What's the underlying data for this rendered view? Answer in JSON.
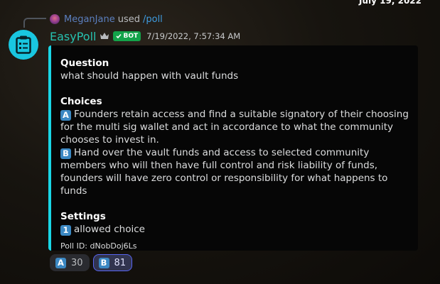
{
  "top_date": "July 19, 2022",
  "reply": {
    "user": "MeganJane",
    "used": "used",
    "command": "/poll"
  },
  "message": {
    "author": "EasyPoll",
    "bot_tag": "BOT",
    "timestamp": "7/19/2022, 7:57:34 AM",
    "avatar_icon": "clipboard-icon",
    "accent_color": "#19d6e6"
  },
  "embed": {
    "question_label": "Question",
    "question": "what should happen with vault funds",
    "choices_label": "Choices",
    "choices": [
      {
        "letter": "A",
        "text": "Founders retain access and find a suitable signatory of their choosing for the multi sig wallet and act in accordance to what the community chooses to invest in."
      },
      {
        "letter": "B",
        "text": "Hand over the vault funds and access to selected community members who will then have full control and risk liability of funds, founders will have zero control or responsibility for what happens to funds"
      }
    ],
    "settings_label": "Settings",
    "settings_number": "1",
    "settings_text": "allowed choice",
    "footer": "Poll ID: dNobDoj6Ls"
  },
  "reactions": [
    {
      "letter": "A",
      "count": "30",
      "active": false
    },
    {
      "letter": "B",
      "count": "81",
      "active": true
    }
  ]
}
